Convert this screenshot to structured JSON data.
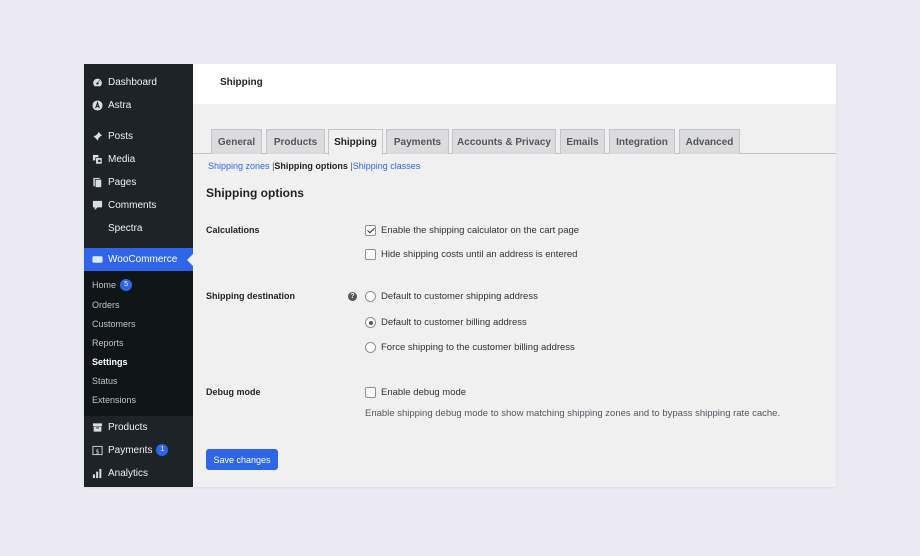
{
  "sidebar": {
    "items_top": [
      {
        "label": "Dashboard",
        "icon": "dashboard-icon"
      },
      {
        "label": "Astra",
        "icon": "astra-icon"
      },
      {
        "label": "Posts",
        "icon": "pin-icon"
      },
      {
        "label": "Media",
        "icon": "media-icon"
      },
      {
        "label": "Pages",
        "icon": "pages-icon"
      },
      {
        "label": "Comments",
        "icon": "comments-icon"
      },
      {
        "label": "Spectra",
        "icon": ""
      }
    ],
    "woocommerce": {
      "label": "WooCommerce",
      "icon": "woo-icon"
    },
    "submenu": [
      {
        "label": "Home",
        "badge": "5"
      },
      {
        "label": "Orders"
      },
      {
        "label": "Customers"
      },
      {
        "label": "Reports"
      },
      {
        "label": "Settings"
      },
      {
        "label": "Status"
      },
      {
        "label": "Extensions"
      }
    ],
    "items_bottom": [
      {
        "label": "Products",
        "icon": "archive-icon"
      },
      {
        "label": "Payments",
        "icon": "dollar-icon",
        "badge": "1"
      },
      {
        "label": "Analytics",
        "icon": "bar-chart-icon"
      }
    ]
  },
  "header": {
    "title": "Shipping"
  },
  "tabs": [
    "General",
    "Products",
    "Shipping",
    "Payments",
    "Accounts & Privacy",
    "Emails",
    "Integration",
    "Advanced"
  ],
  "active_tab": "Shipping",
  "sublinks": {
    "zones": "Shipping zones",
    "options": "Shipping options",
    "classes": "Shipping classes",
    "separator": "|"
  },
  "section_title": "Shipping options",
  "calculations": {
    "label": "Calculations",
    "options": [
      {
        "label": "Enable the shipping calculator on the cart page",
        "checked": true
      },
      {
        "label": "Hide shipping costs until an address is entered",
        "checked": false
      }
    ]
  },
  "destination": {
    "label": "Shipping destination",
    "help": "?",
    "options": [
      {
        "label": "Default to customer shipping address",
        "selected": false
      },
      {
        "label": "Default to customer billing address",
        "selected": true
      },
      {
        "label": "Force shipping to the customer billing address",
        "selected": false
      }
    ]
  },
  "debug": {
    "label": "Debug mode",
    "option": "Enable debug mode",
    "checked": false,
    "description": "Enable shipping debug mode to show matching shipping zones and to bypass shipping rate cache."
  },
  "save_label": "Save changes",
  "colors": {
    "accent": "#2f66e8",
    "sidebar": "#1d2327",
    "submenu": "#101517"
  }
}
